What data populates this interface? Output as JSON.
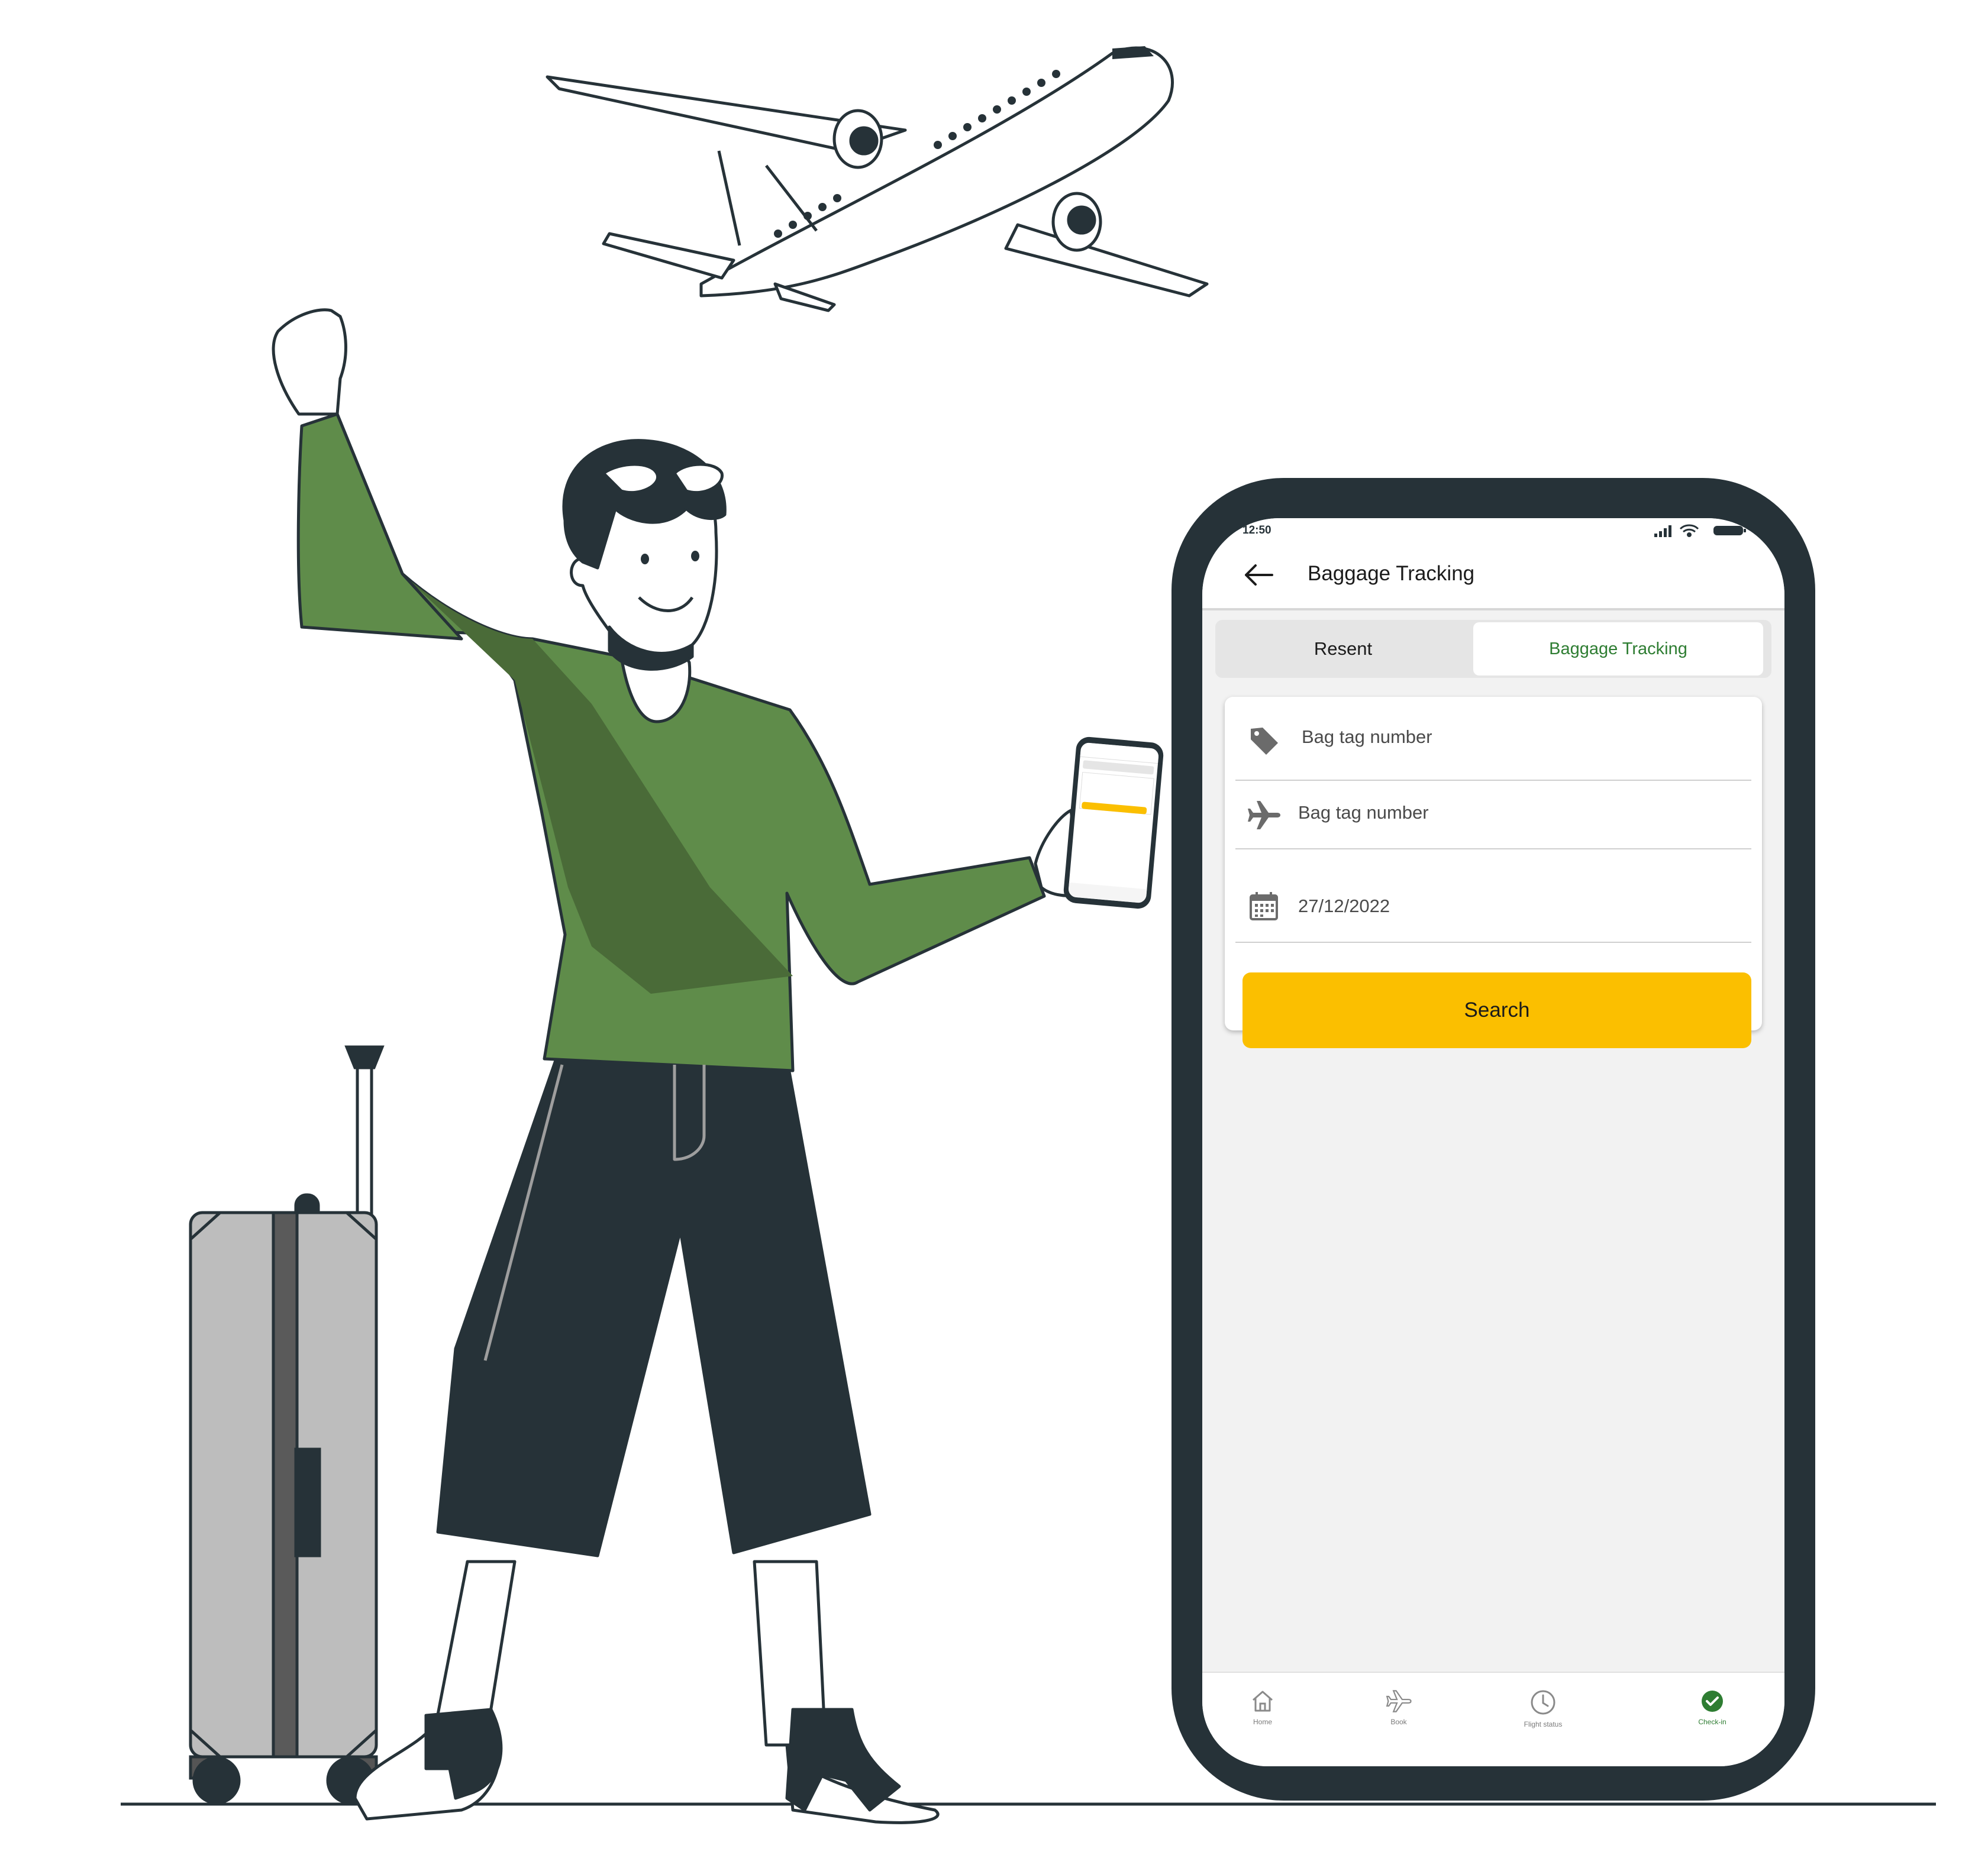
{
  "status_bar": {
    "time": "12:50"
  },
  "header": {
    "back_icon": "arrow-left-icon",
    "title": "Baggage Tracking"
  },
  "tabs": [
    {
      "label": "Resent",
      "active": false
    },
    {
      "label": "Baggage Tracking",
      "active": true
    }
  ],
  "form": {
    "fields": [
      {
        "icon": "tag-icon",
        "placeholder": "Bag tag number"
      },
      {
        "icon": "airplane-icon",
        "placeholder": "Bag tag number"
      },
      {
        "icon": "calendar-icon",
        "value": "27/12/2022"
      }
    ],
    "search_label": "Search"
  },
  "bottom_nav": [
    {
      "icon": "home-icon",
      "label": "Home"
    },
    {
      "icon": "airplane-icon",
      "label": "Book"
    },
    {
      "icon": "clock-icon",
      "label": "Flight status"
    },
    {
      "icon": "check-circle-icon",
      "label": "Check-in",
      "active": true
    }
  ],
  "colors": {
    "accent_green": "#2e7d32",
    "button_yellow": "#fbbf00",
    "phone_frame": "#263238",
    "shirt_green": "#5f8c4a",
    "suitcase_gray": "#bdbdbd"
  }
}
